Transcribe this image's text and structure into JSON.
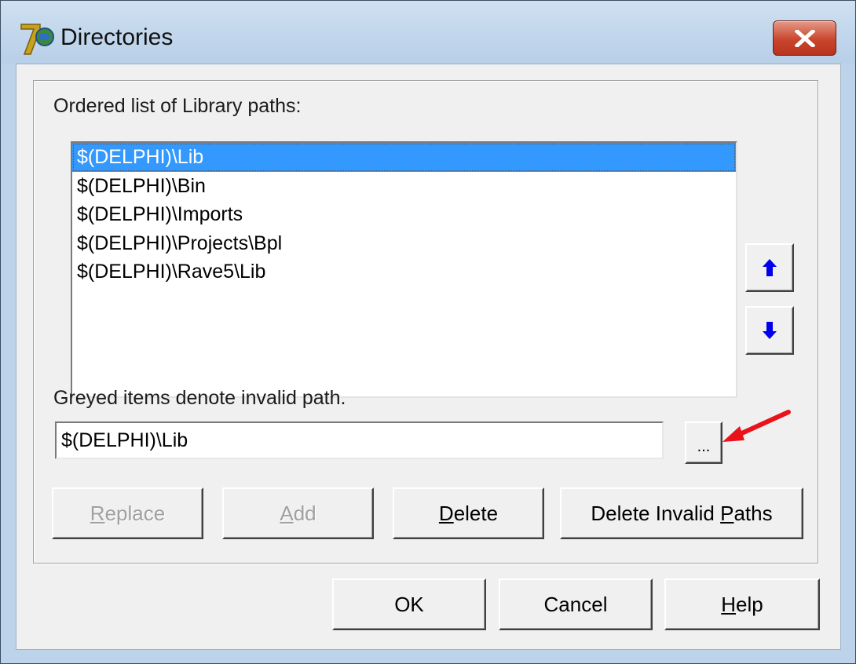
{
  "window": {
    "title": "Directories",
    "app_icon": "delphi-7-icon",
    "close_icon": "close-icon"
  },
  "list": {
    "label": "Ordered list of Library paths:",
    "items": [
      "$(DELPHI)\\Lib",
      "$(DELPHI)\\Bin",
      "$(DELPHI)\\Imports",
      "$(DELPHI)\\Projects\\Bpl",
      "$(DELPHI)\\Rave5\\Lib"
    ],
    "selected_index": 0
  },
  "hint": "Greyed items denote invalid path.",
  "path_input": {
    "value": "$(DELPHI)\\Lib"
  },
  "browse_button": "...",
  "buttons": {
    "replace_prefix": "",
    "replace_access": "R",
    "replace_rest": "eplace",
    "add_access": "A",
    "add_rest": "dd",
    "delete_access": "D",
    "delete_rest": "elete",
    "delete_invalid_before": "Delete Invalid ",
    "delete_invalid_access": "P",
    "delete_invalid_after": "aths",
    "ok": "OK",
    "cancel": "Cancel",
    "help_access": "H",
    "help_rest": "elp"
  },
  "move_up_icon": "arrow-up-icon",
  "move_down_icon": "arrow-down-icon",
  "annotation_icon": "red-arrow-icon",
  "colors": {
    "selection": "#3399ff",
    "arrow_blue": "#0000ee",
    "annotation_red": "#e8141a",
    "close_button": "#c9452c"
  }
}
